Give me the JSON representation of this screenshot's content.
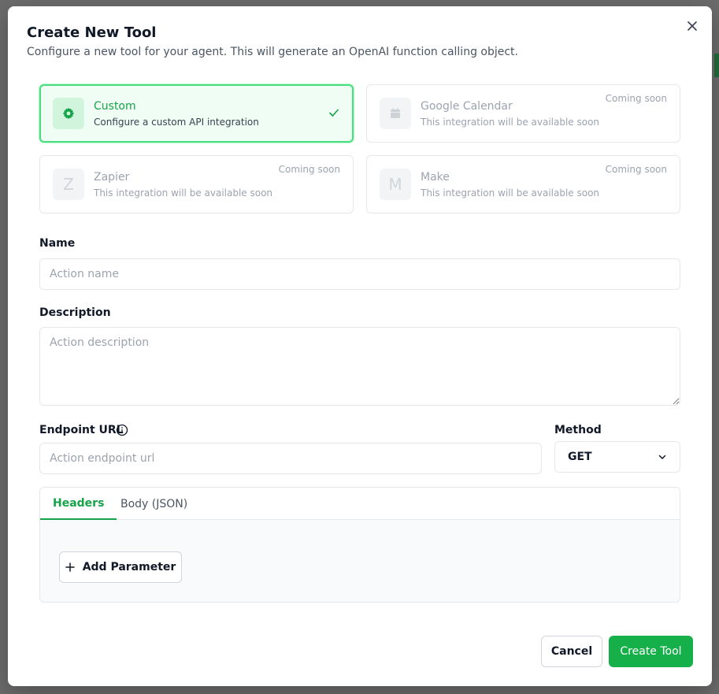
{
  "modal": {
    "title": "Create New Tool",
    "subtitle": "Configure a new tool for your agent. This will generate an OpenAI function calling object."
  },
  "tools": [
    {
      "name": "Custom",
      "description": "Configure a custom API integration",
      "selected": true,
      "badge": "",
      "icon": "gear-icon"
    },
    {
      "name": "Google Calendar",
      "description": "This integration will be available soon",
      "selected": false,
      "badge": "Coming soon",
      "icon": "calendar-icon"
    },
    {
      "name": "Zapier",
      "description": "This integration will be available soon",
      "selected": false,
      "badge": "Coming soon",
      "icon": "Z"
    },
    {
      "name": "Make",
      "description": "This integration will be available soon",
      "selected": false,
      "badge": "Coming soon",
      "icon": "M"
    }
  ],
  "form": {
    "name_label": "Name",
    "name_placeholder": "Action name",
    "description_label": "Description",
    "description_placeholder": "Action description",
    "endpoint_label": "Endpoint URL",
    "endpoint_placeholder": "Action endpoint url",
    "method_label": "Method",
    "method_value": "GET"
  },
  "tabs": {
    "items": [
      "Headers",
      "Body (JSON)"
    ],
    "active": "Headers",
    "add_parameter_label": "Add Parameter"
  },
  "footer": {
    "cancel_label": "Cancel",
    "create_label": "Create Tool"
  },
  "colors": {
    "accent": "#16a34a",
    "primary_button": "#16b04a",
    "selected_border": "#4ade80",
    "selected_bg": "#f0fdf4"
  }
}
